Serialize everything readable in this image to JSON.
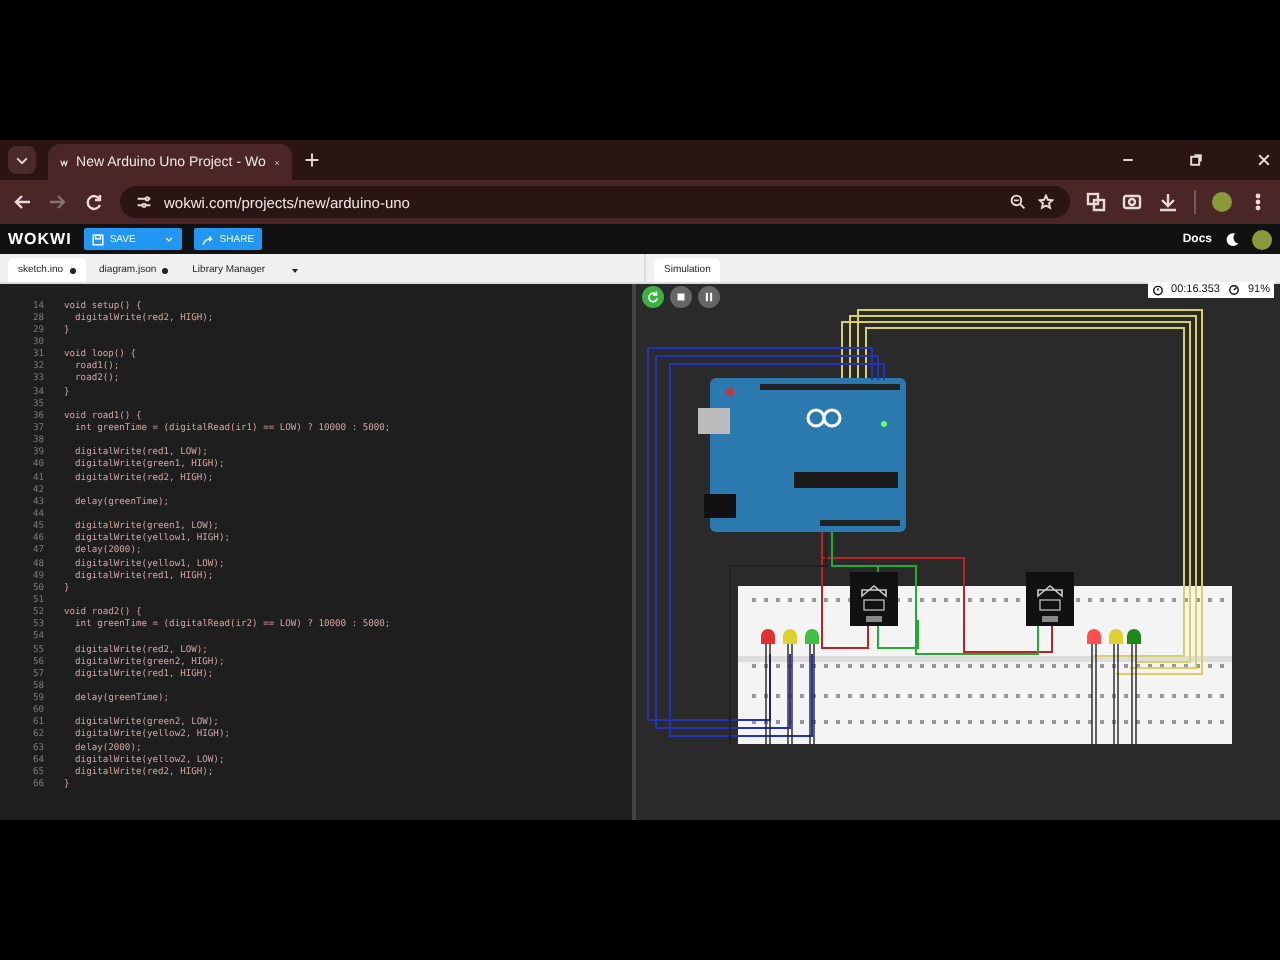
{
  "browser": {
    "tab_title": "New Arduino Uno Project - Wo",
    "url": "wokwi.com/projects/new/arduino-uno"
  },
  "app_header": {
    "logo": "WOKWI",
    "save": "SAVE",
    "share": "SHARE",
    "docs": "Docs"
  },
  "editor_tabs": [
    {
      "label": "sketch.ino",
      "selected": true,
      "modified": true,
      "kind": "file"
    },
    {
      "label": "diagram.json",
      "selected": false,
      "modified": true,
      "kind": "file"
    },
    {
      "label": "Library Manager",
      "selected": false,
      "modified": false,
      "kind": "menu"
    }
  ],
  "code": [
    {
      "number": "14",
      "text": "void setup() {"
    },
    {
      "number": "28",
      "text": "  digitalWrite(red2, HIGH);"
    },
    {
      "number": "29",
      "text": "}"
    },
    {
      "number": "30"
    },
    {
      "number": "31",
      "text": "void loop() {"
    },
    {
      "number": "32",
      "text": "  road1();"
    },
    {
      "number": "33",
      "text": "  road2();"
    },
    {
      "number": "34",
      "text": "}"
    },
    {
      "number": "35"
    },
    {
      "number": "36",
      "text": "void road1() {"
    },
    {
      "number": "37",
      "text": "  int greenTime = (digitalRead(ir1) == LOW) ? 10000 : 5000;"
    },
    {
      "number": "38"
    },
    {
      "number": "39",
      "text": "  digitalWrite(red1, LOW);"
    },
    {
      "number": "40",
      "text": "  digitalWrite(green1, HIGH);"
    },
    {
      "number": "41",
      "text": "  digitalWrite(red2, HIGH);"
    },
    {
      "number": "42"
    },
    {
      "number": "43",
      "text": "  delay(greenTime);"
    },
    {
      "number": "44"
    },
    {
      "number": "45",
      "text": "  digitalWrite(green1, LOW);"
    },
    {
      "number": "46",
      "text": "  digitalWrite(yellow1, HIGH);"
    },
    {
      "number": "47",
      "text": "  delay(2000);"
    },
    {
      "number": "48",
      "text": "  digitalWrite(yellow1, LOW);"
    },
    {
      "number": "49",
      "text": "  digitalWrite(red1, HIGH);"
    },
    {
      "number": "50",
      "text": "}"
    },
    {
      "number": "51"
    },
    {
      "number": "52",
      "text": "void road2() {"
    },
    {
      "number": "53",
      "text": "  int greenTime = (digitalRead(ir2) == LOW) ? 10000 : 5000;"
    },
    {
      "number": "54"
    },
    {
      "number": "55",
      "text": "  digitalWrite(red2, LOW);"
    },
    {
      "number": "56",
      "text": "  digitalWrite(green2, HIGH);"
    },
    {
      "number": "57",
      "text": "  digitalWrite(red1, HIGH);"
    },
    {
      "number": "58"
    },
    {
      "number": "59",
      "text": "  delay(greenTime);"
    },
    {
      "number": "60"
    },
    {
      "number": "61",
      "text": "  digitalWrite(green2, LOW);"
    },
    {
      "number": "62",
      "text": "  digitalWrite(yellow2, HIGH);"
    },
    {
      "number": "63",
      "text": "  delay(2000);"
    },
    {
      "number": "64",
      "text": "  digitalWrite(yellow2, LOW);"
    },
    {
      "number": "65",
      "text": "  digitalWrite(red2, HIGH);"
    },
    {
      "number": "66",
      "text": "}"
    }
  ],
  "simulation": {
    "tab": "Simulation",
    "timer": "00:16.353",
    "load": "91%"
  }
}
